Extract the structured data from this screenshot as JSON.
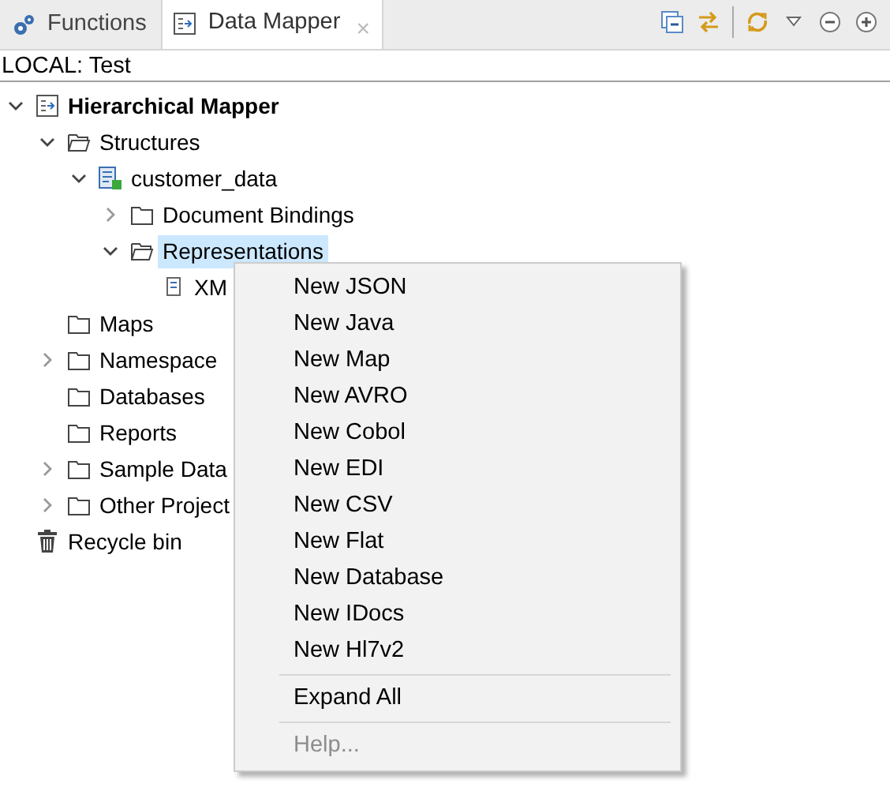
{
  "tabs": [
    {
      "label": "Functions",
      "kind": "functions",
      "selected": false,
      "closable": false
    },
    {
      "label": "Data Mapper",
      "kind": "mapper",
      "selected": true,
      "closable": true
    }
  ],
  "close_glyph": "×",
  "context_label": "LOCAL: Test",
  "tree": [
    {
      "label": "Hierarchical Mapper",
      "kind": "mapper",
      "expanded": true,
      "selected": false,
      "children": [
        {
          "label": "Structures",
          "kind": "open-folder",
          "expanded": true,
          "selected": false,
          "children": [
            {
              "label": "customer_data",
              "kind": "structure",
              "expanded": true,
              "selected": false,
              "children": [
                {
                  "label": "Document Bindings",
                  "kind": "folder",
                  "expanded": false,
                  "selected": false
                },
                {
                  "label": "Representations",
                  "kind": "open-folder",
                  "expanded": true,
                  "selected": true,
                  "children": [
                    {
                      "label": "XM",
                      "kind": "file",
                      "selected": false
                    }
                  ]
                }
              ]
            }
          ]
        },
        {
          "label": "Maps",
          "kind": "folder",
          "selected": false
        },
        {
          "label": "Namespace",
          "kind": "folder",
          "expanded": false,
          "selected": false
        },
        {
          "label": "Databases",
          "kind": "folder",
          "selected": false
        },
        {
          "label": "Reports",
          "kind": "folder",
          "selected": false
        },
        {
          "label": "Sample Data",
          "kind": "folder",
          "expanded": false,
          "selected": false
        },
        {
          "label": "Other Project",
          "kind": "folder",
          "expanded": false,
          "selected": false
        }
      ]
    },
    {
      "label": "Recycle bin",
      "kind": "trash",
      "selected": false
    }
  ],
  "context_menu": {
    "groups": [
      [
        {
          "label": "New JSON",
          "disabled": false
        },
        {
          "label": "New Java",
          "disabled": false
        },
        {
          "label": "New Map",
          "disabled": false
        },
        {
          "label": "New AVRO",
          "disabled": false
        },
        {
          "label": "New Cobol",
          "disabled": false
        },
        {
          "label": "New EDI",
          "disabled": false
        },
        {
          "label": "New CSV",
          "disabled": false
        },
        {
          "label": "New Flat",
          "disabled": false
        },
        {
          "label": "New Database",
          "disabled": false
        },
        {
          "label": "New IDocs",
          "disabled": false
        },
        {
          "label": "New Hl7v2",
          "disabled": false
        }
      ],
      [
        {
          "label": "Expand All",
          "disabled": false
        }
      ],
      [
        {
          "label": "Help...",
          "disabled": true
        }
      ]
    ]
  }
}
